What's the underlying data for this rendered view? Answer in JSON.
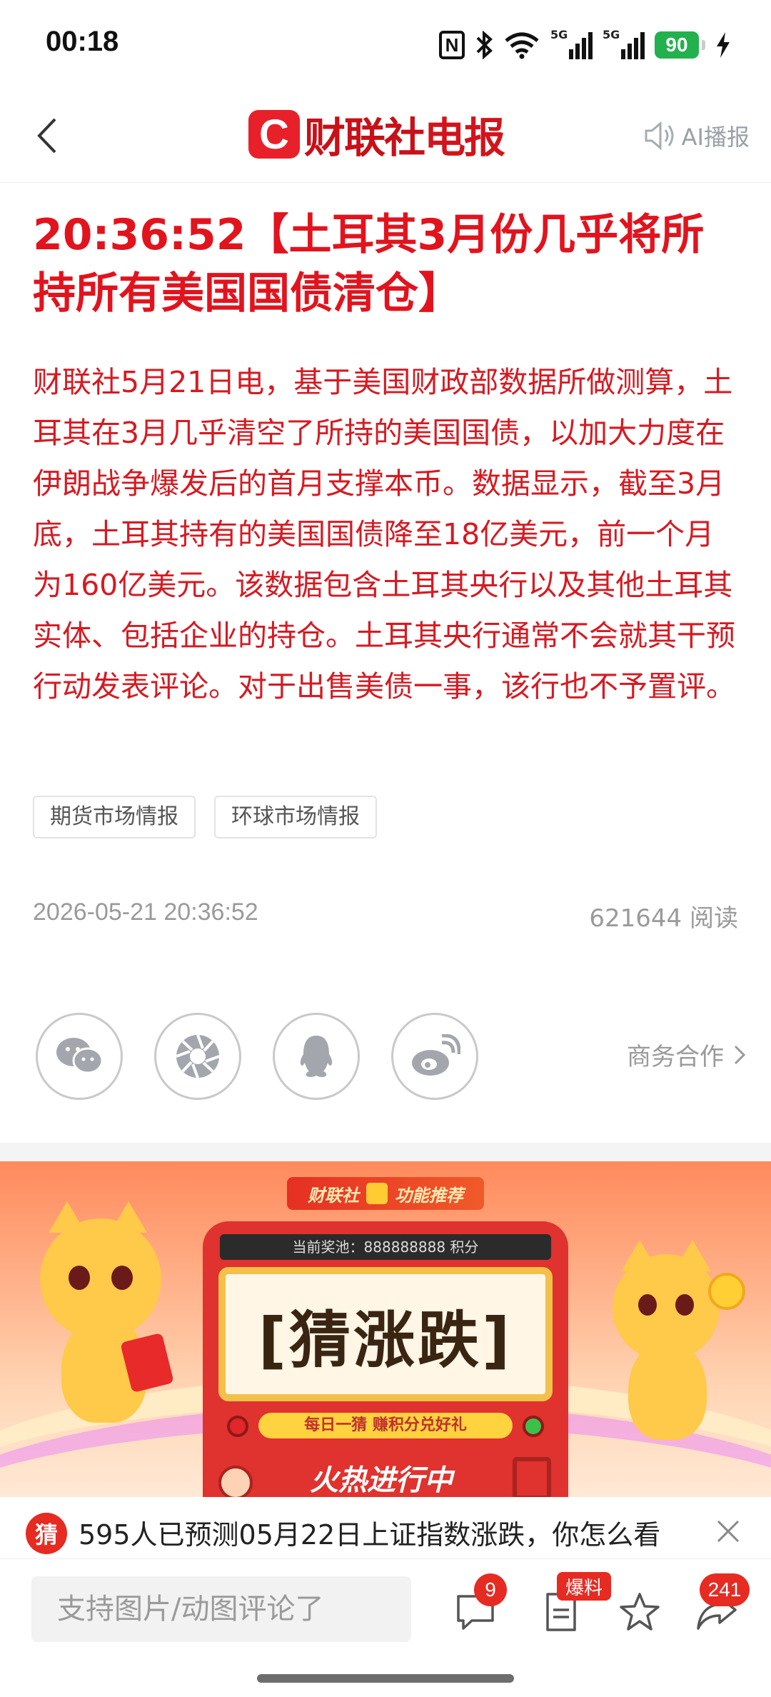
{
  "status_bar": {
    "time": "00:18",
    "battery": "90",
    "signal_1_label": "5G",
    "signal_2_label": "5G"
  },
  "header": {
    "logo_mark": "C",
    "logo_text_a": "财联社",
    "logo_text_b": "电报",
    "ai_label": "AI播报"
  },
  "article": {
    "title": "20:36:52【土耳其3月份几乎将所持所有美国国债清仓】",
    "body": "财联社5月21日电，基于美国财政部数据所做测算，土耳其在3月几乎清空了所持的美国国债，以加大力度在伊朗战争爆发后的首月支撑本币。数据显示，截至3月底，土耳其持有的美国国债降至18亿美元，前一个月为160亿美元。该数据包含土耳其央行以及其他土耳其实体、包括企业的持仓。土耳其央行通常不会就其干预行动发表评论。对于出售美债一事，该行也不予置评。",
    "tags": [
      "期货市场情报",
      "环球市场情报"
    ],
    "datetime": "2026-05-21 20:36:52",
    "reads": "621644 阅读"
  },
  "share": {
    "icons": [
      "wechat-icon",
      "moments-icon",
      "qq-icon",
      "weibo-icon"
    ],
    "business_link": "商务合作"
  },
  "banner": {
    "badge_brand": "财联社",
    "badge_label": "功能推荐",
    "prize_pool": "当前奖池：888888888 积分",
    "game_title": "[猜涨跌]",
    "daily": "每日一猜 赚积分兑好礼",
    "hot": "火热进行中"
  },
  "prediction": {
    "badge": "猜",
    "text": "595人已预测05月22日上证指数涨跌，你怎么看"
  },
  "bottom_bar": {
    "comment_placeholder": "支持图片/动图评论了",
    "comment_count": "9",
    "tip_label": "爆料",
    "share_count": "241"
  },
  "colors": {
    "brand_red": "#e1141e",
    "body_red": "#d61a22",
    "badge_red": "#e62b22",
    "battery_green": "#22b14c"
  }
}
